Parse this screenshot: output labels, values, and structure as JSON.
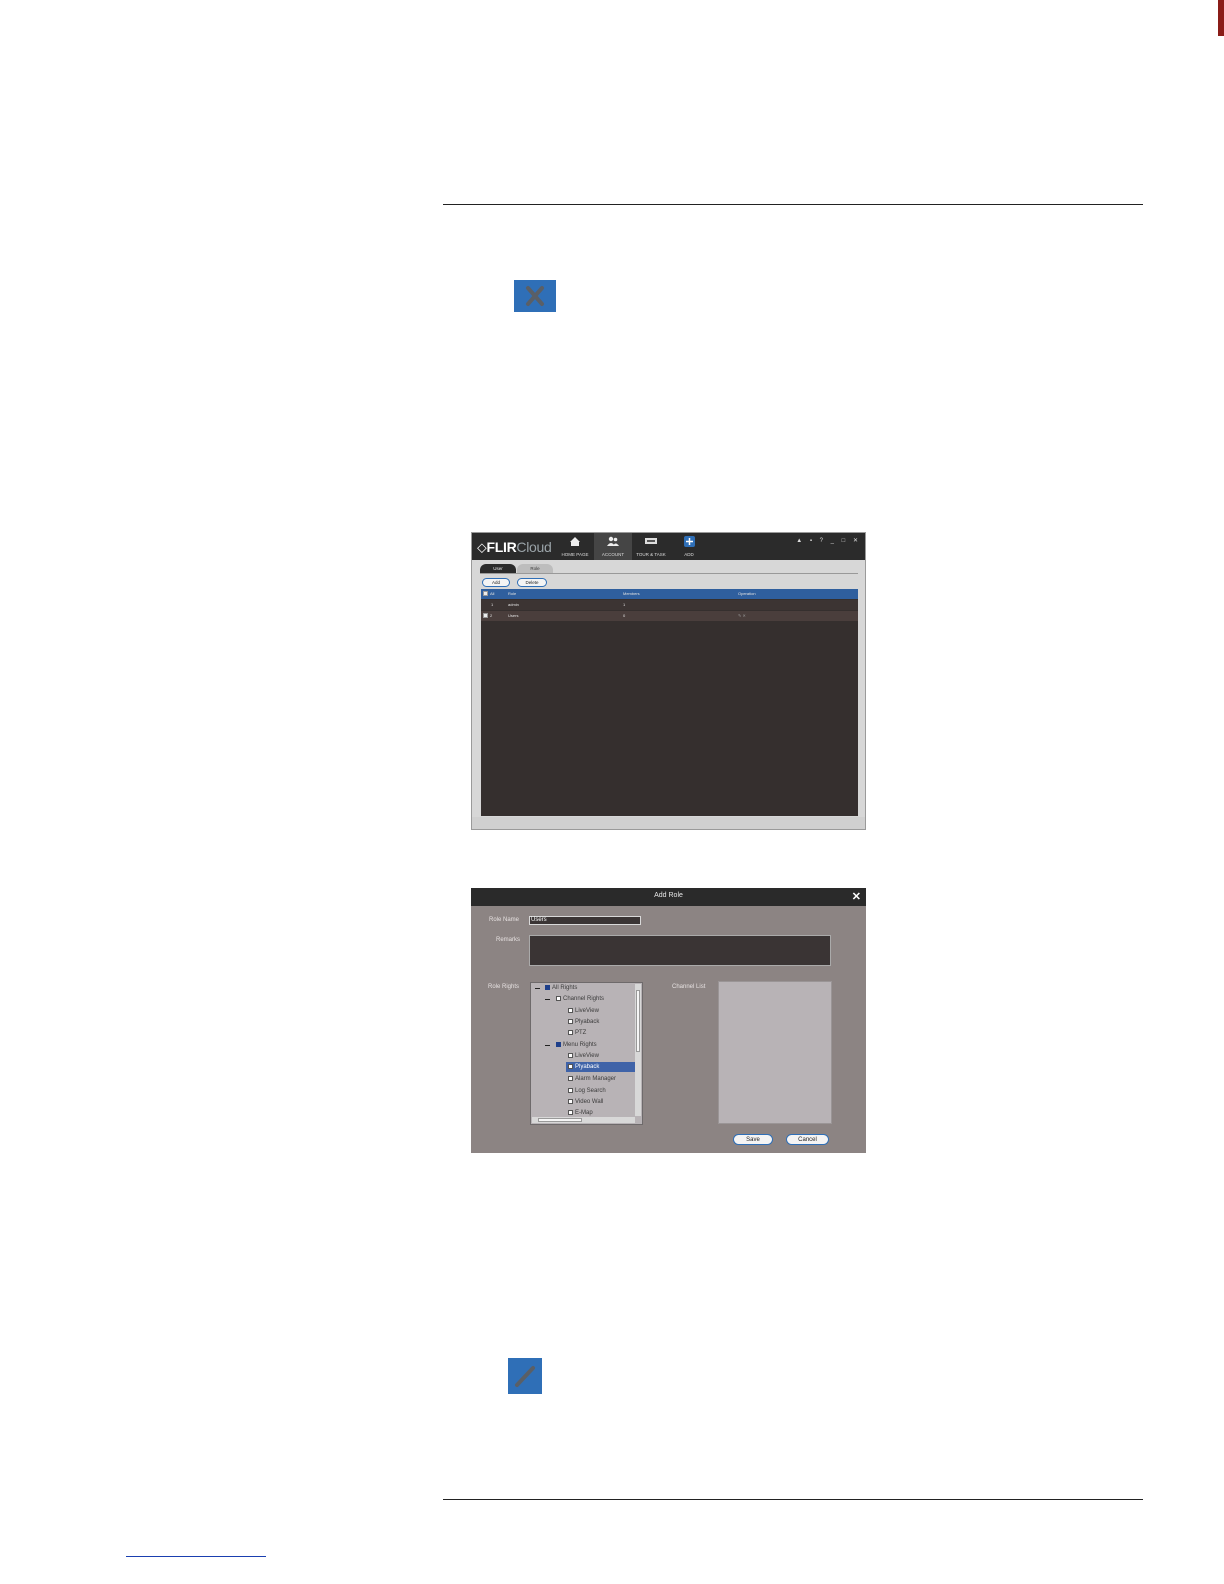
{
  "page": {
    "colors": {
      "rule": "#222222",
      "accent_blue": "#2f6fb7",
      "side_mark": "#8a1c18"
    }
  },
  "icons": {
    "delete_icon": "close-x",
    "edit_icon": "pencil"
  },
  "window1": {
    "logo_bold": "FLIR",
    "logo_light": "Cloud",
    "nav": [
      {
        "label": "HOME PAGE",
        "icon": "home-icon"
      },
      {
        "label": "ACCOUNT",
        "icon": "users-icon"
      },
      {
        "label": "TOUR & TASK",
        "icon": "tour-icon"
      },
      {
        "label": "ADD",
        "icon": "plus-icon"
      }
    ],
    "window_controls": "▲ ▪ ? _ □ ✕",
    "subtabs": {
      "user": "User",
      "role": "Role"
    },
    "buttons": {
      "add": "Add",
      "delete": "Delete"
    },
    "table": {
      "headers": {
        "all": "All",
        "role": "Role",
        "members": "Members",
        "operation": "Operation"
      },
      "rows": [
        {
          "no": "1",
          "role": "admin",
          "members": "1",
          "operation": ""
        },
        {
          "no": "2",
          "role": "Users",
          "members": "0",
          "operation": "✎ ✕"
        }
      ]
    }
  },
  "dialog": {
    "title": "Add Role",
    "close": "✕",
    "role_name_label": "Role Name",
    "role_name_value": "Users",
    "remarks_label": "Remarks",
    "role_rights_label": "Role Rights",
    "channel_list_label": "Channel List",
    "tree": {
      "all_rights": "All Rights",
      "channel_rights": "Channel Rights",
      "channel_items": [
        "LiveView",
        "Plyaback",
        "PTZ"
      ],
      "menu_rights": "Menu Rights",
      "menu_items": [
        "LiveView",
        "Plyaback",
        "Alarm Manager",
        "Log Search",
        "Video Wall",
        "E-Map"
      ]
    },
    "buttons": {
      "save": "Save",
      "cancel": "Cancel"
    }
  }
}
